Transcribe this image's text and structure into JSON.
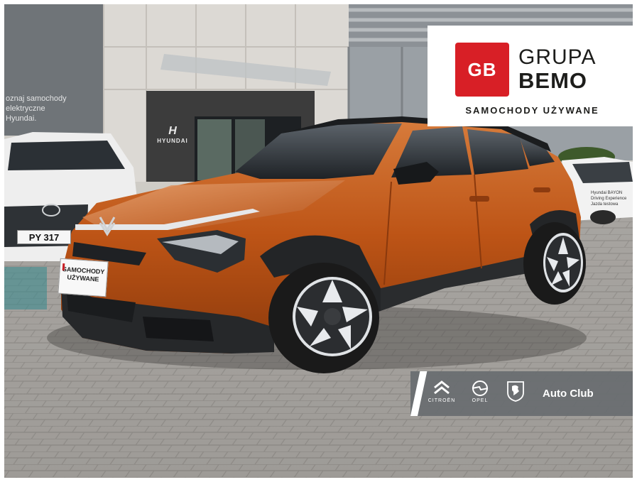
{
  "image": {
    "description_colors": {
      "car_body": "#c65a1e",
      "bemo_red": "#d81f26",
      "banner_gray": "#686c70"
    }
  },
  "logo": {
    "badge": "GB",
    "line1": "GRUPA",
    "line2": "BEMO",
    "tagline": "SAMOCHODY UŻYWANE"
  },
  "banner": {
    "brands": [
      {
        "name": "CITROËN",
        "icon": "citroen-chevrons-icon"
      },
      {
        "name": "OPEL",
        "icon": "opel-blitz-icon"
      },
      {
        "name": "peugeot-lion",
        "icon": "peugeot-lion-icon"
      }
    ],
    "title": "Auto Club"
  },
  "car": {
    "front_plate_line1": "SAMOCHODY",
    "front_plate_line2": "UŻYWANE",
    "white_car_plate": "PY 317"
  },
  "background": {
    "window_text": "oznaj samochody\nelektryczne\nHyundai.",
    "dealer_brand": "HYUNDAI",
    "sign_text": "Hyundai BAYON\nDriving Experience\nJazda testowa"
  }
}
